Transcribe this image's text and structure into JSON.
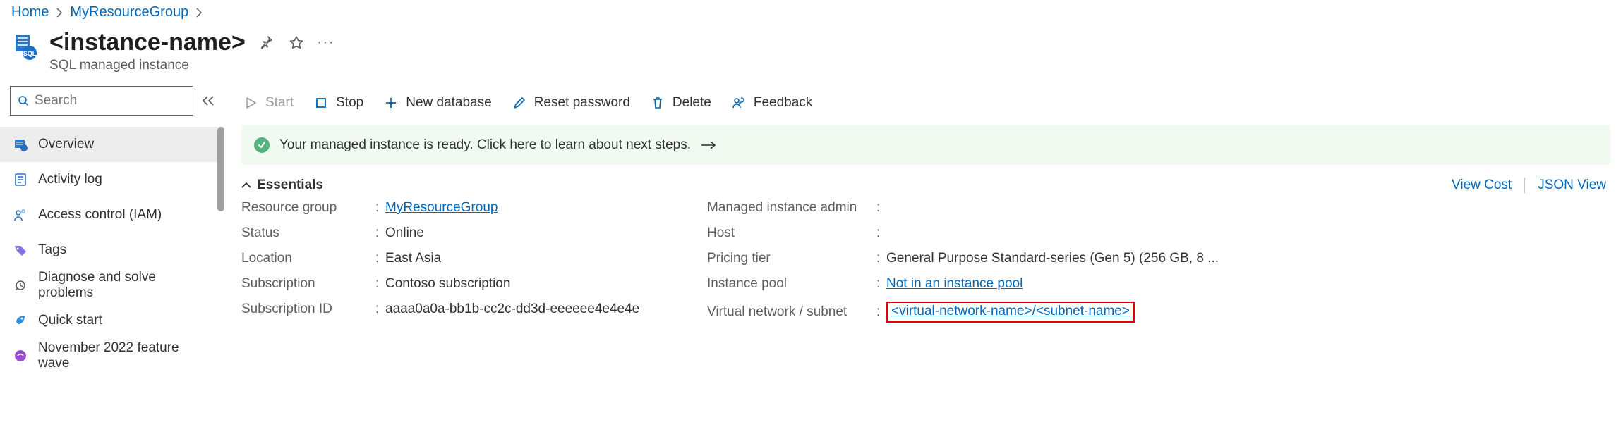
{
  "breadcrumb": {
    "home": "Home",
    "group": "MyResourceGroup"
  },
  "header": {
    "title": "<instance-name>",
    "subtitle": "SQL managed instance"
  },
  "search": {
    "placeholder": "Search"
  },
  "nav": {
    "overview": "Overview",
    "activity_log": "Activity log",
    "access_control": "Access control (IAM)",
    "tags": "Tags",
    "diagnose": "Diagnose and solve problems",
    "quick_start": "Quick start",
    "feature_wave": "November 2022 feature wave"
  },
  "toolbar": {
    "start": "Start",
    "stop": "Stop",
    "new_database": "New database",
    "reset_password": "Reset password",
    "delete": "Delete",
    "feedback": "Feedback"
  },
  "banner": {
    "text": "Your managed instance is ready. Click here to learn about next steps."
  },
  "essentials": {
    "label": "Essentials",
    "view_cost": "View Cost",
    "json_view": "JSON View",
    "left": {
      "resource_group_label": "Resource group",
      "resource_group_value": "MyResourceGroup",
      "status_label": "Status",
      "status_value": "Online",
      "location_label": "Location",
      "location_value": "East Asia",
      "subscription_label": "Subscription",
      "subscription_value": "Contoso subscription",
      "subscription_id_label": "Subscription ID",
      "subscription_id_value": "aaaa0a0a-bb1b-cc2c-dd3d-eeeeee4e4e4e"
    },
    "right": {
      "admin_label": "Managed instance admin",
      "admin_value": "",
      "host_label": "Host",
      "host_value": "",
      "pricing_label": "Pricing tier",
      "pricing_value": "General Purpose Standard-series (Gen 5) (256 GB, 8 ...",
      "pool_label": "Instance pool",
      "pool_value": "Not in an instance pool",
      "vnet_label": "Virtual network / subnet",
      "vnet_value": "<virtual-network-name>/<subnet-name>"
    }
  }
}
